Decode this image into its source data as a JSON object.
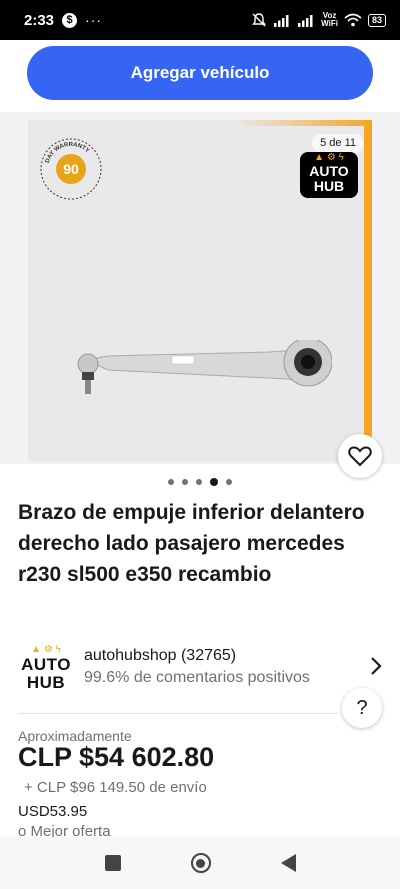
{
  "status_bar": {
    "time": "2:33",
    "money_icon": "$",
    "more": "···",
    "voz_line1": "Voz",
    "voz_line2": "WiFi",
    "battery": "83"
  },
  "top": {
    "add_vehicle_label": "Agregar vehículo"
  },
  "gallery": {
    "counter": "5 de 11",
    "warranty_days": "90",
    "warranty_text": "DAY WARRANTY",
    "brand_line1": "AUTO",
    "brand_line2": "HUB",
    "dots_count": 5,
    "active_dot": 3
  },
  "listing": {
    "title": "Brazo de empuje inferior delantero derecho lado pasajero mercedes r230 sl500 e350 recambio"
  },
  "seller": {
    "logo_line1": "AUTO",
    "logo_line2": "HUB",
    "name": "autohubshop (32765)",
    "feedback": "99.6% de comentarios positivos"
  },
  "price": {
    "approx_label": "Aproximadamente",
    "amount": "CLP $54 602.80",
    "shipping": "+ CLP $96 149.50 de envío",
    "usd": "USD53.95",
    "best_offer": "o Mejor oferta"
  },
  "colors": {
    "primary": "#3665f3",
    "accent_orange": "#f5a623"
  }
}
